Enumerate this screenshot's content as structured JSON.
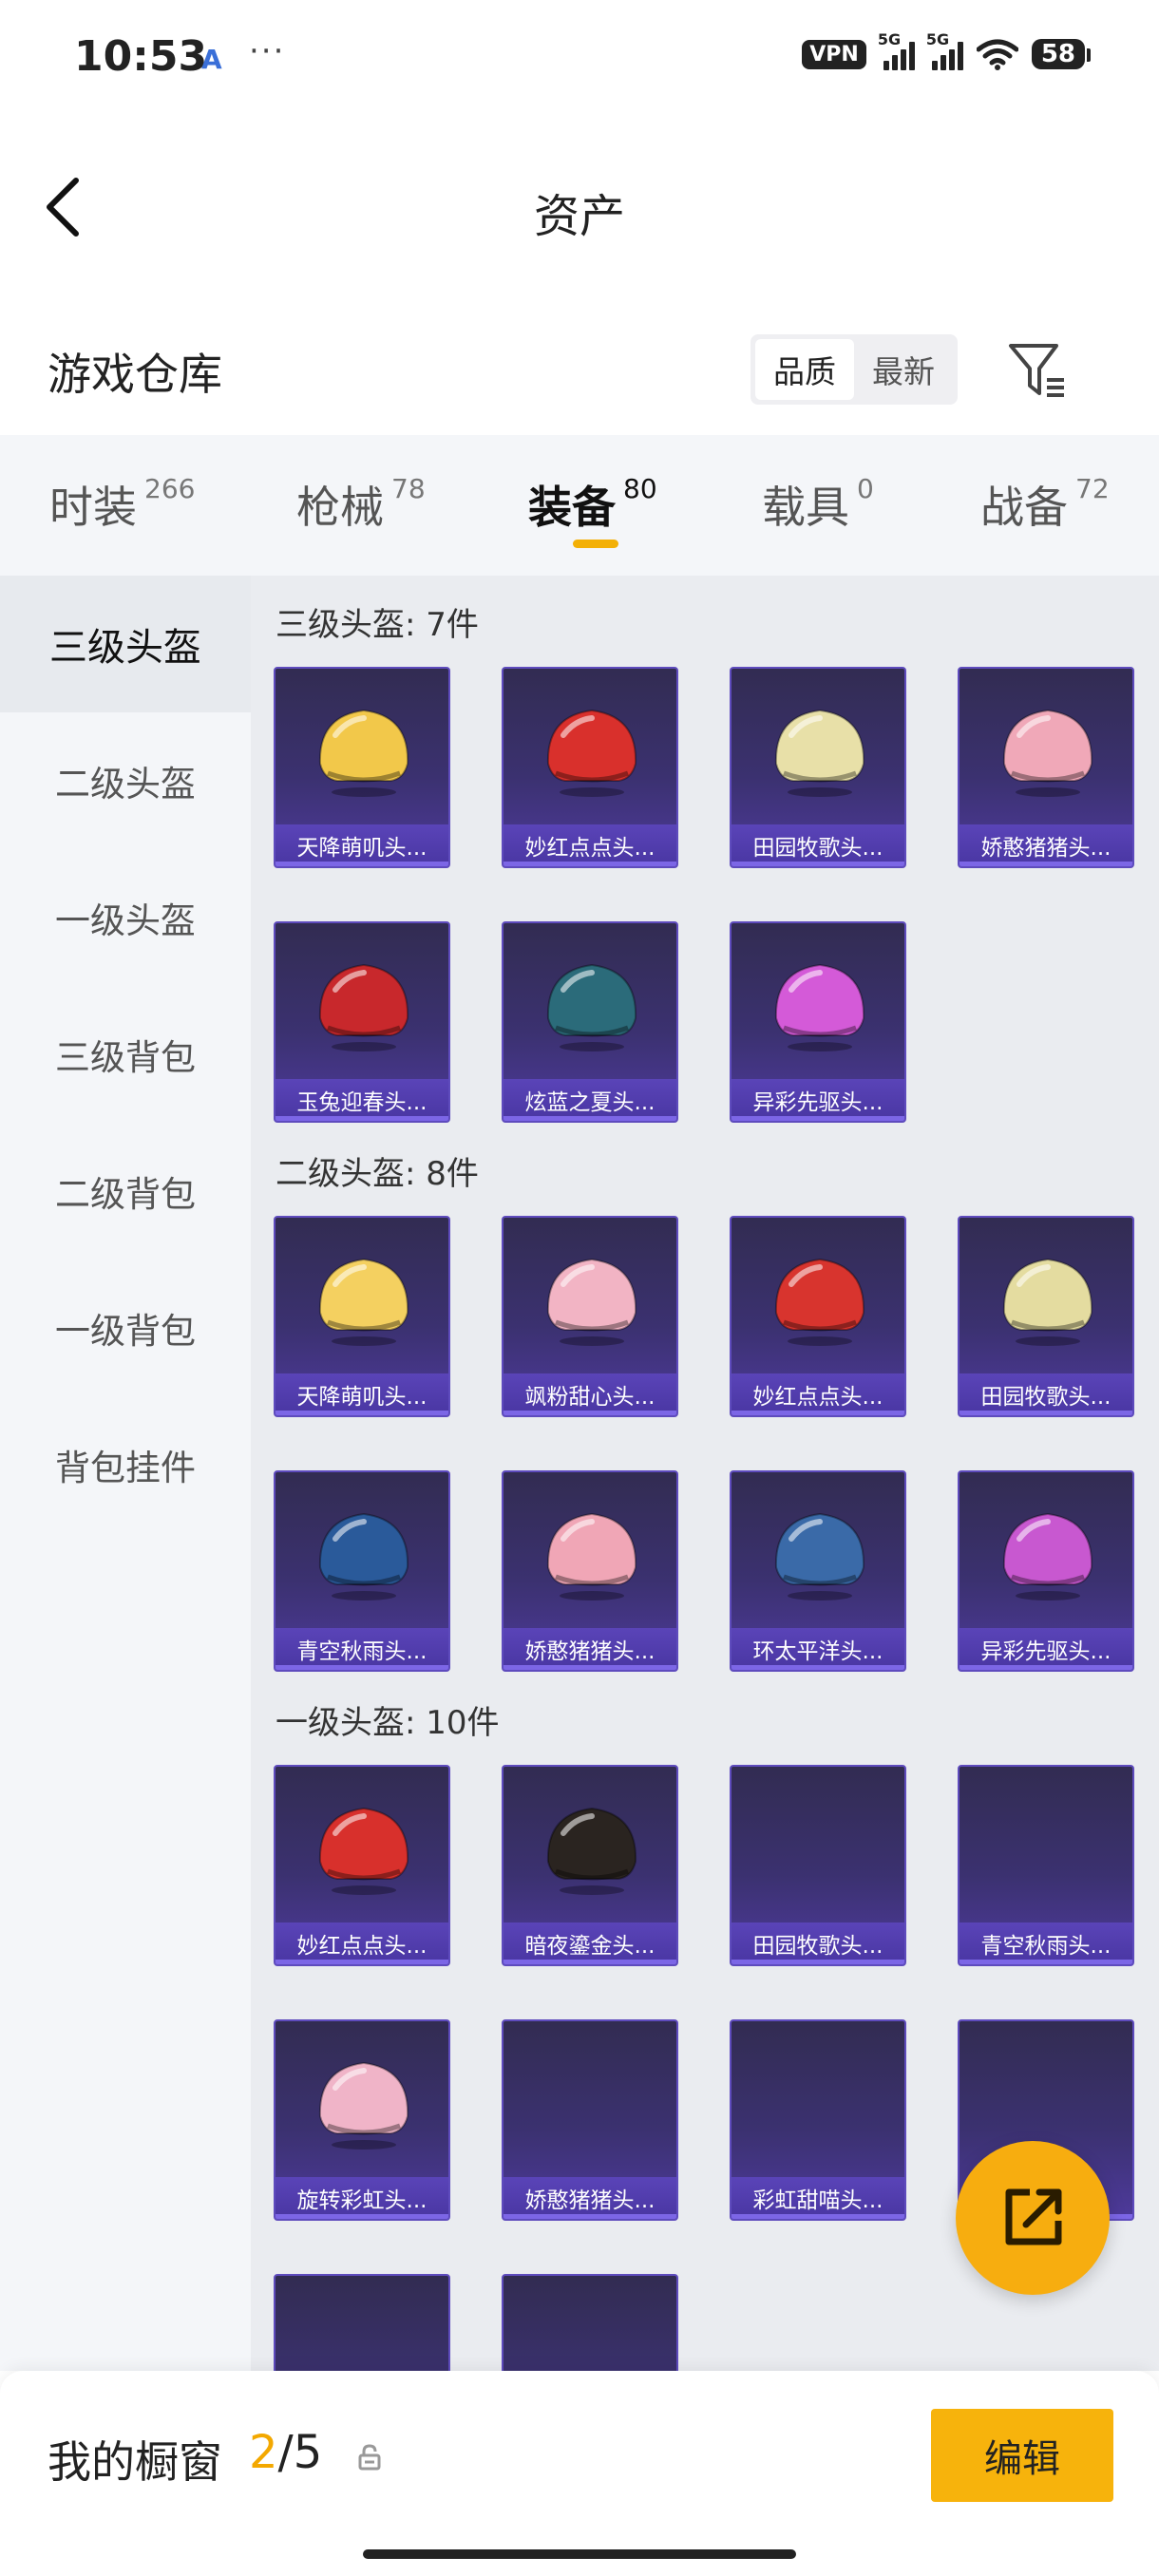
{
  "status_bar": {
    "time": "10:53",
    "icon_a": "A",
    "dots": "···",
    "vpn": "VPN",
    "sim1": "5G",
    "sim2": "5G",
    "battery": "58"
  },
  "header": {
    "title": "资产"
  },
  "warehouse": {
    "title": "游戏仓库",
    "sort_options": [
      "品质",
      "最新"
    ],
    "sort_active": "品质"
  },
  "tabs": [
    {
      "label": "时装",
      "count": "266"
    },
    {
      "label": "枪械",
      "count": "78"
    },
    {
      "label": "装备",
      "count": "80"
    },
    {
      "label": "载具",
      "count": "0"
    },
    {
      "label": "战备",
      "count": "72"
    }
  ],
  "active_tab": "装备",
  "sidebar": {
    "items": [
      "三级头盔",
      "二级头盔",
      "一级头盔",
      "三级背包",
      "二级背包",
      "一级背包",
      "背包挂件"
    ],
    "active": "三级头盔"
  },
  "sections": [
    {
      "title": "三级头盔: 7件",
      "items": [
        {
          "name": "天降萌叽头...",
          "icon": "helmet-yellow-icon",
          "color": "#f2c84a"
        },
        {
          "name": "妙红点点头...",
          "icon": "helmet-red-icon",
          "color": "#d9302c"
        },
        {
          "name": "田园牧歌头...",
          "icon": "helmet-cream-icon",
          "color": "#e8e0a8"
        },
        {
          "name": "娇憨猪猪头...",
          "icon": "helmet-pink-icon",
          "color": "#f0a8b8"
        },
        {
          "name": "玉兔迎春头...",
          "icon": "helmet-redwhite-icon",
          "color": "#c8282c"
        },
        {
          "name": "炫蓝之夏头...",
          "icon": "helmet-teal-icon",
          "color": "#2b6b7a"
        },
        {
          "name": "异彩先驱头...",
          "icon": "helmet-purple-icon",
          "color": "#d45ad8"
        }
      ]
    },
    {
      "title": "二级头盔: 8件",
      "items": [
        {
          "name": "天降萌叽头...",
          "icon": "helmet-yellow-icon",
          "color": "#f4d060"
        },
        {
          "name": "飒粉甜心头...",
          "icon": "helmet-pink-icon",
          "color": "#f2b4c4"
        },
        {
          "name": "妙红点点头...",
          "icon": "helmet-red-icon",
          "color": "#d8342e"
        },
        {
          "name": "田园牧歌头...",
          "icon": "helmet-cream-icon",
          "color": "#e4dca0"
        },
        {
          "name": "青空秋雨头...",
          "icon": "helmet-blue-icon",
          "color": "#2a5a9a"
        },
        {
          "name": "娇憨猪猪头...",
          "icon": "helmet-pink-icon",
          "color": "#f0a6b6"
        },
        {
          "name": "环太平洋头...",
          "icon": "helmet-blue-icon",
          "color": "#3a6aa8"
        },
        {
          "name": "异彩先驱头...",
          "icon": "helmet-purple-icon",
          "color": "#c858d0"
        }
      ]
    },
    {
      "title": "一级头盔: 10件",
      "items": [
        {
          "name": "妙红点点头...",
          "icon": "helmet-red-icon",
          "color": "#d8302c"
        },
        {
          "name": "暗夜鎏金头...",
          "icon": "helmet-black-icon",
          "color": "#2a2420"
        },
        {
          "name": "田园牧歌头...",
          "icon": "",
          "color": ""
        },
        {
          "name": "青空秋雨头...",
          "icon": "",
          "color": ""
        },
        {
          "name": "旋转彩虹头...",
          "icon": "helmet-pinkwhite-icon",
          "color": "#f0b4c8"
        },
        {
          "name": "娇憨猪猪头...",
          "icon": "",
          "color": ""
        },
        {
          "name": "彩虹甜喵头...",
          "icon": "",
          "color": ""
        },
        {
          "name": "",
          "icon": "",
          "color": ""
        },
        {
          "name": "",
          "icon": "",
          "color": ""
        },
        {
          "name": "",
          "icon": "",
          "color": ""
        }
      ]
    }
  ],
  "showcase": {
    "label": "我的橱窗",
    "current": "2",
    "separator": "/",
    "total": "5",
    "edit_label": "编辑"
  },
  "colors": {
    "accent": "#f7b30c",
    "card_purple": "#4e3a9c",
    "tab_bg": "#f4f6f9"
  }
}
